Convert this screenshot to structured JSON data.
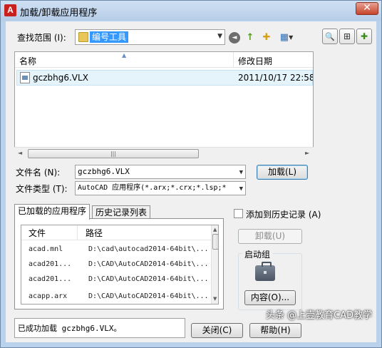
{
  "window": {
    "title": "加载/卸载应用程序",
    "close_glyph": "✕"
  },
  "lookin": {
    "label": "查找范围 (I):",
    "value": "编号工具"
  },
  "toolbar": {
    "back_glyph": "◄",
    "up_glyph": "↑",
    "new_folder_glyph": "✚",
    "views_glyph": "▦",
    "find_glyph": "🔍",
    "tools1_glyph": "⊞",
    "tools2_glyph": "✚"
  },
  "filelist": {
    "col_name": "名称",
    "col_date": "修改日期",
    "rows": [
      {
        "name": "gczbhg6.VLX",
        "date": "2011/10/17 22:58"
      }
    ]
  },
  "filename": {
    "label": "文件名 (N):",
    "value": "gczbhg6.VLX"
  },
  "filetype": {
    "label": "文件类型 (T):",
    "value": "AutoCAD 应用程序(*.arx;*.crx;*.lsp;*"
  },
  "load_button": "加载(L)",
  "tabs": {
    "loaded_label": "已加载的应用程序",
    "history_label": "历史记录列表"
  },
  "apps_table": {
    "col_file": "文件",
    "col_path": "路径",
    "rows": [
      {
        "file": "acad.mnl",
        "path": "D:\\cad\\autocad2014-64bit\\..."
      },
      {
        "file": "acad201...",
        "path": "D:\\CAD\\AutoCAD2014-64bit\\..."
      },
      {
        "file": "acad201...",
        "path": "D:\\CAD\\AutoCAD2014-64bit\\..."
      },
      {
        "file": "acapp.arx",
        "path": "D:\\CAD\\AutoCAD2014-64bit\\..."
      }
    ]
  },
  "add_history_label": "添加到历史记录 (A)",
  "unload_button": "卸载(U)",
  "startup": {
    "legend": "启动组",
    "contents_button": "内容(O)..."
  },
  "status_text": "已成功加载 gczbhg6.VLX。",
  "close_button": "关闭(C)",
  "help_button": "帮助(H)",
  "watermark": "头条 @上壹教育CAD教学"
}
